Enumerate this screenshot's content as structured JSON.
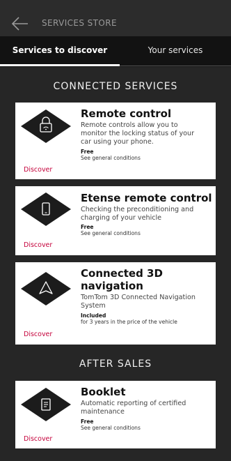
{
  "header": {
    "title": "SERVICES STORE"
  },
  "tabs": [
    {
      "label": "Services to discover"
    },
    {
      "label": "Your services"
    }
  ],
  "sections": [
    {
      "title": "CONNECTED SERVICES",
      "cards": [
        {
          "title": "Remote control",
          "desc": [
            "Remote controls allow you to",
            "monitor the locking status of your",
            "car using your phone."
          ],
          "price": "Free",
          "condition": "See general conditions",
          "action": "Discover",
          "icon": "lock-wifi-icon"
        },
        {
          "title": "Etense remote control",
          "desc": [
            "Checking the preconditioning and",
            "charging of your vehicle"
          ],
          "price": "Free",
          "condition": "See general conditions",
          "action": "Discover",
          "icon": "phone-icon"
        },
        {
          "title_lines": [
            "Connected 3D",
            "navigation"
          ],
          "desc": [
            "TomTom 3D Connected Navigation",
            "System"
          ],
          "price": "Included",
          "condition": "for 3 years in the price of the vehicle",
          "action": "Discover",
          "icon": "navigation-arrow-icon"
        }
      ]
    },
    {
      "title": "AFTER SALES",
      "cards": [
        {
          "title": "Booklet",
          "desc": [
            "Automatic reporting of certified",
            "maintenance"
          ],
          "price": "Free",
          "condition": "See general conditions",
          "action": "Discover",
          "icon": "booklet-icon"
        }
      ]
    }
  ],
  "colors": {
    "background": "#262626",
    "tab_bar": "#121212",
    "accent": "#c4003a",
    "card": "#ffffff",
    "diamond": "#1c1c1c"
  }
}
